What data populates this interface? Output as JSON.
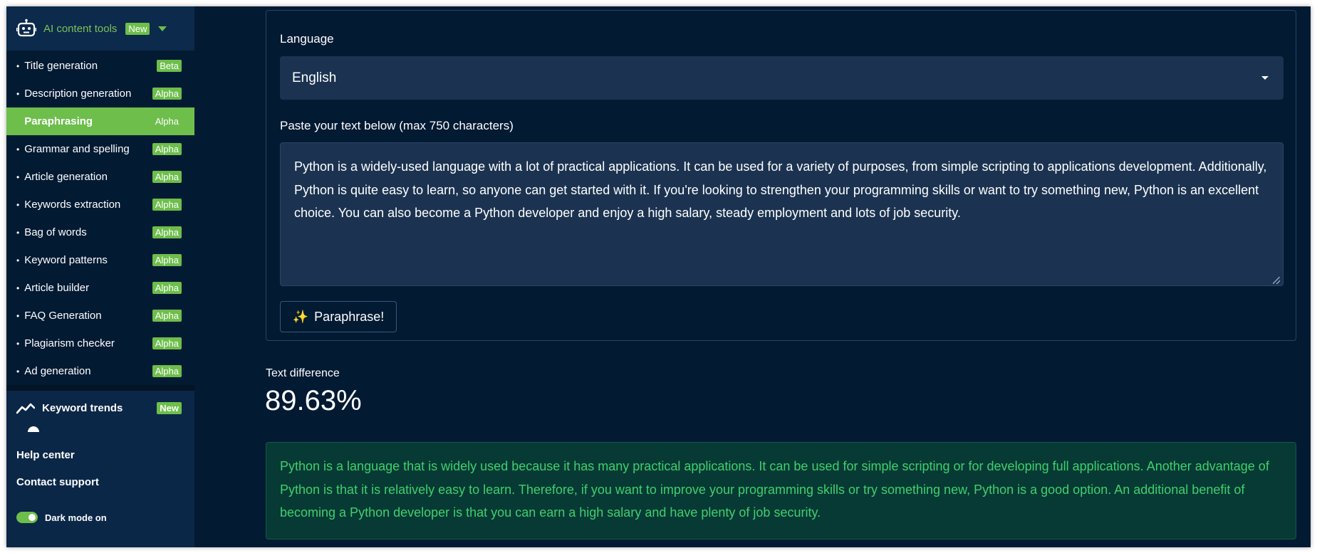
{
  "sidebar": {
    "group": {
      "title": "AI content tools",
      "badge": "New"
    },
    "tools": [
      {
        "label": "Title generation",
        "badge": "Beta"
      },
      {
        "label": "Description generation",
        "badge": "Alpha"
      },
      {
        "label": "Paraphrasing",
        "badge": "Alpha",
        "active": true
      },
      {
        "label": "Grammar and spelling",
        "badge": "Alpha"
      },
      {
        "label": "Article generation",
        "badge": "Alpha"
      },
      {
        "label": "Keywords extraction",
        "badge": "Alpha"
      },
      {
        "label": "Bag of words",
        "badge": "Alpha"
      },
      {
        "label": "Keyword patterns",
        "badge": "Alpha"
      },
      {
        "label": "Article builder",
        "badge": "Alpha"
      },
      {
        "label": "FAQ Generation",
        "badge": "Alpha"
      },
      {
        "label": "Plagiarism checker",
        "badge": "Alpha"
      },
      {
        "label": "Ad generation",
        "badge": "Alpha"
      }
    ],
    "keyword_trends": {
      "label": "Keyword trends",
      "badge": "New"
    },
    "help_center": "Help center",
    "contact_support": "Contact support",
    "dark_mode": {
      "label": "Dark mode on",
      "on": true
    }
  },
  "form": {
    "language_label": "Language",
    "language_value": "English",
    "paste_label": "Paste your text below (max 750 characters)",
    "input_text": "Python is a widely-used language with a lot of practical applications. It can be used for a variety of purposes, from simple scripting to applications development. Additionally, Python is quite easy to learn, so anyone can get started with it. If you're looking to strengthen your programming skills or want to try something new, Python is an excellent choice. You can also become a Python developer and enjoy a high salary, steady employment and lots of job security.",
    "button_label": "Paraphrase!",
    "button_icon": "sparkles-icon"
  },
  "result": {
    "diff_label": "Text difference",
    "diff_value": "89.63%",
    "output_text": "Python is a language that is widely used because it has many practical applications. It can be used for simple scripting or for developing full applications. Another advantage of Python is that it is relatively easy to learn. Therefore, if you want to improve your programming skills or try something new, Python is a good option. An additional benefit of becoming a Python developer is that you can earn a high salary and have plenty of job security."
  },
  "colors": {
    "background": "#031a33",
    "sidebar": "#0b2747",
    "accent_green": "#6dbe4b",
    "result_bg": "#073a34",
    "result_text": "#3fcf6e",
    "input_bg": "#1b3350"
  }
}
